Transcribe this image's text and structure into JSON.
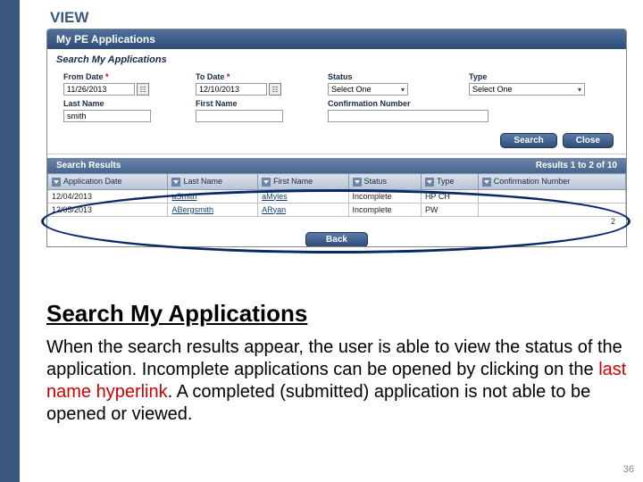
{
  "slide": {
    "view_label": "VIEW",
    "heading": "Search My Applications",
    "paragraph_pre": "When the search results appear, the user is able to view the status of the application.  Incomplete applications can be opened by clicking on the ",
    "paragraph_link": "last name hyperlink",
    "paragraph_post": ".  A completed (submitted) application is not able to be opened or viewed.",
    "page_number": "36"
  },
  "app": {
    "title": "My PE Applications",
    "search_heading": "Search My Applications",
    "filters": {
      "from_date": {
        "label": "From Date",
        "required": "*",
        "value": "11/26/2013"
      },
      "to_date": {
        "label": "To Date",
        "required": "*",
        "value": "12/10/2013"
      },
      "status": {
        "label": "Status",
        "value": "Select One"
      },
      "type": {
        "label": "Type",
        "value": "Select One"
      },
      "last_name": {
        "label": "Last Name",
        "value": "smith"
      },
      "first_name": {
        "label": "First Name",
        "value": ""
      },
      "conf_num": {
        "label": "Confirmation Number",
        "value": ""
      }
    },
    "buttons": {
      "search": "Search",
      "close": "Close",
      "back": "Back"
    },
    "results": {
      "heading": "Search Results",
      "count_text": "Results 1 to 2 of 10",
      "pager": "2",
      "columns": [
        "Application Date",
        "Last Name",
        "First Name",
        "Status",
        "Type",
        "Confirmation Number"
      ],
      "rows": [
        {
          "date": "12/04/2013",
          "last": "aSmith",
          "first": "aMyles",
          "status": "Incomplete",
          "type": "HP CH",
          "conf": ""
        },
        {
          "date": "12/05/2013",
          "last": "ABergsmith",
          "first": "ARyan",
          "status": "Incomplete",
          "type": "PW",
          "conf": ""
        }
      ]
    }
  }
}
